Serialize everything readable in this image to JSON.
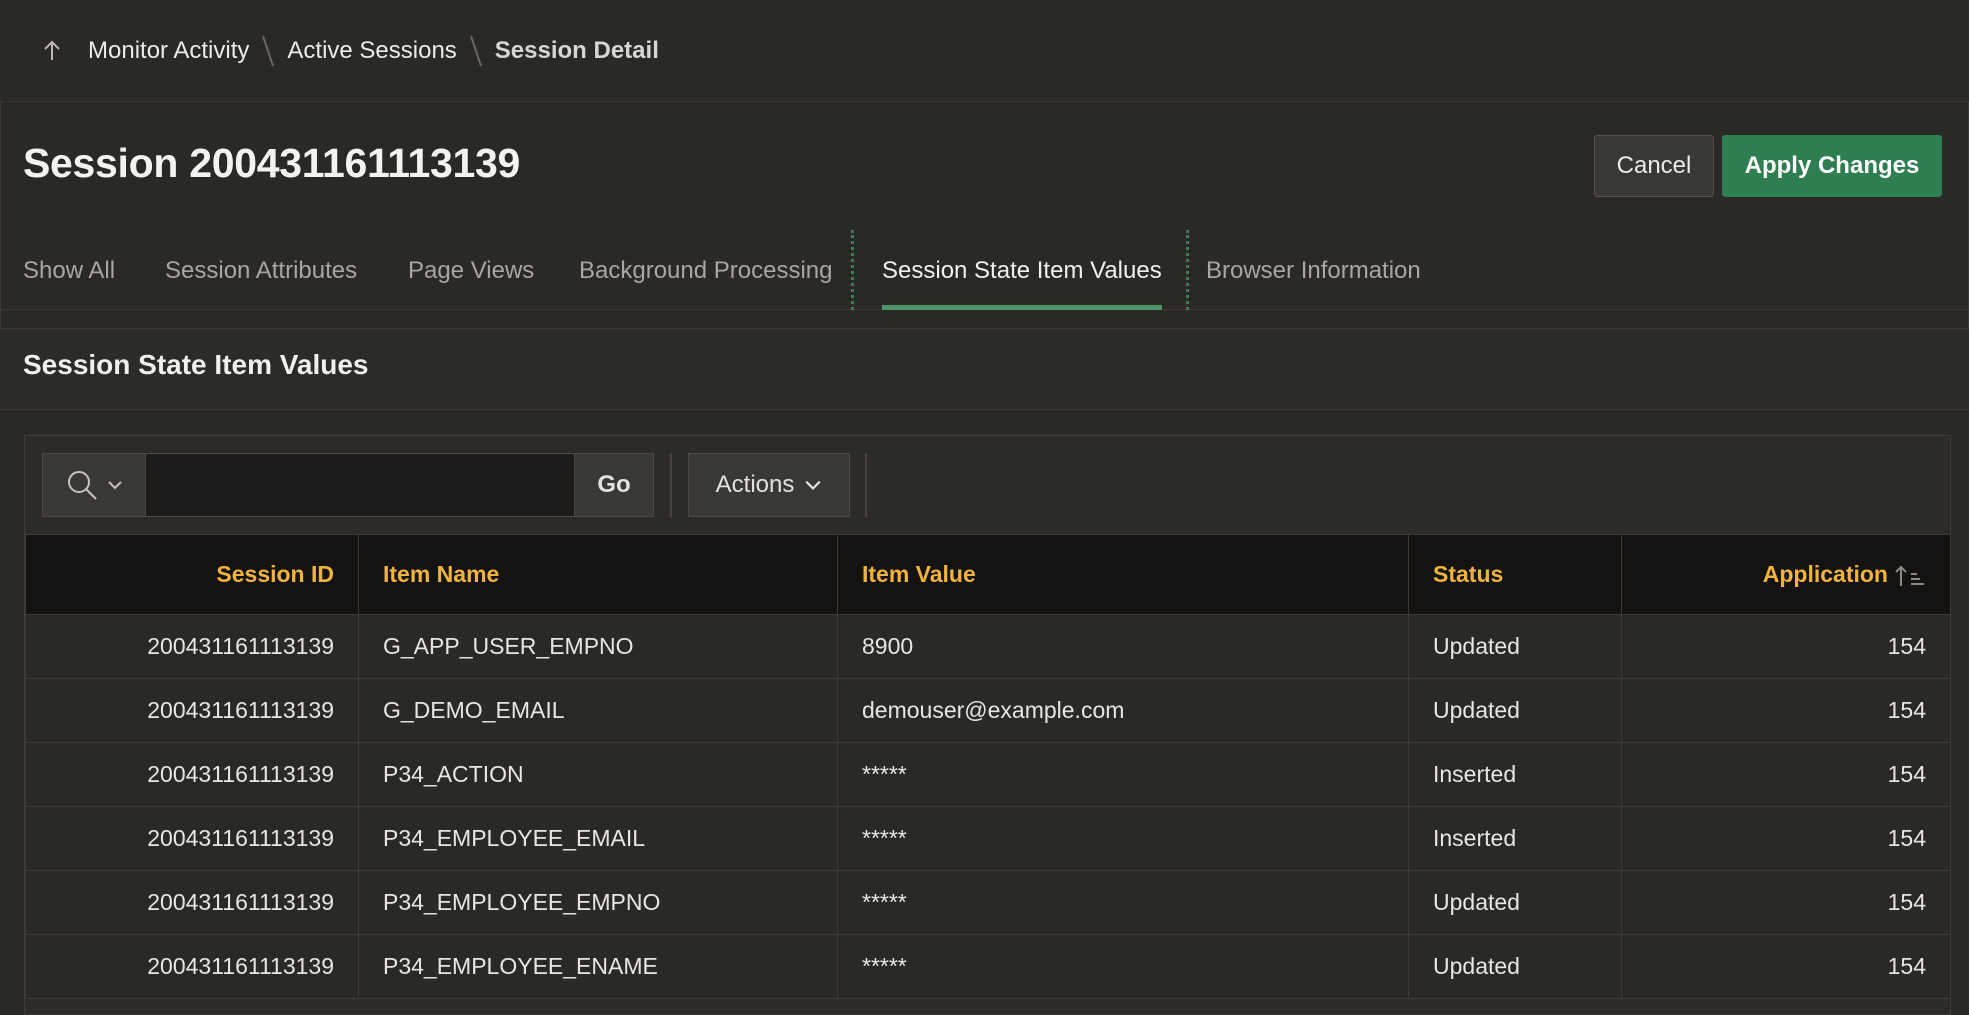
{
  "breadcrumb": {
    "items": [
      "Monitor Activity",
      "Active Sessions"
    ],
    "current": "Session Detail"
  },
  "page": {
    "title": "Session 200431161113139",
    "cancel_label": "Cancel",
    "apply_label": "Apply Changes"
  },
  "tabs": [
    {
      "label": "Show All"
    },
    {
      "label": "Session Attributes"
    },
    {
      "label": "Page Views"
    },
    {
      "label": "Background Processing"
    },
    {
      "label": "Session State Item Values",
      "active": true
    },
    {
      "label": "Browser Information"
    }
  ],
  "region": {
    "title": "Session State Item Values"
  },
  "toolbar": {
    "search_icon": "search-icon",
    "search_value": "",
    "go_label": "Go",
    "actions_label": "Actions"
  },
  "table": {
    "columns": [
      "Session ID",
      "Item Name",
      "Item Value",
      "Status",
      "Application"
    ],
    "sorted_column": "Application",
    "rows": [
      [
        "200431161113139",
        "G_APP_USER_EMPNO",
        "8900",
        "Updated",
        "154"
      ],
      [
        "200431161113139",
        "G_DEMO_EMAIL",
        "demouser@example.com",
        "Updated",
        "154"
      ],
      [
        "200431161113139",
        "P34_ACTION",
        "*****",
        "Inserted",
        "154"
      ],
      [
        "200431161113139",
        "P34_EMPLOYEE_EMAIL",
        "*****",
        "Inserted",
        "154"
      ],
      [
        "200431161113139",
        "P34_EMPLOYEE_EMPNO",
        "*****",
        "Updated",
        "154"
      ],
      [
        "200431161113139",
        "P34_EMPLOYEE_ENAME",
        "*****",
        "Updated",
        "154"
      ]
    ]
  },
  "colors": {
    "accent_green": "#2f7e52",
    "tab_underline": "#4a9466",
    "header_text": "#f0b43c",
    "background": "#2b2926"
  }
}
